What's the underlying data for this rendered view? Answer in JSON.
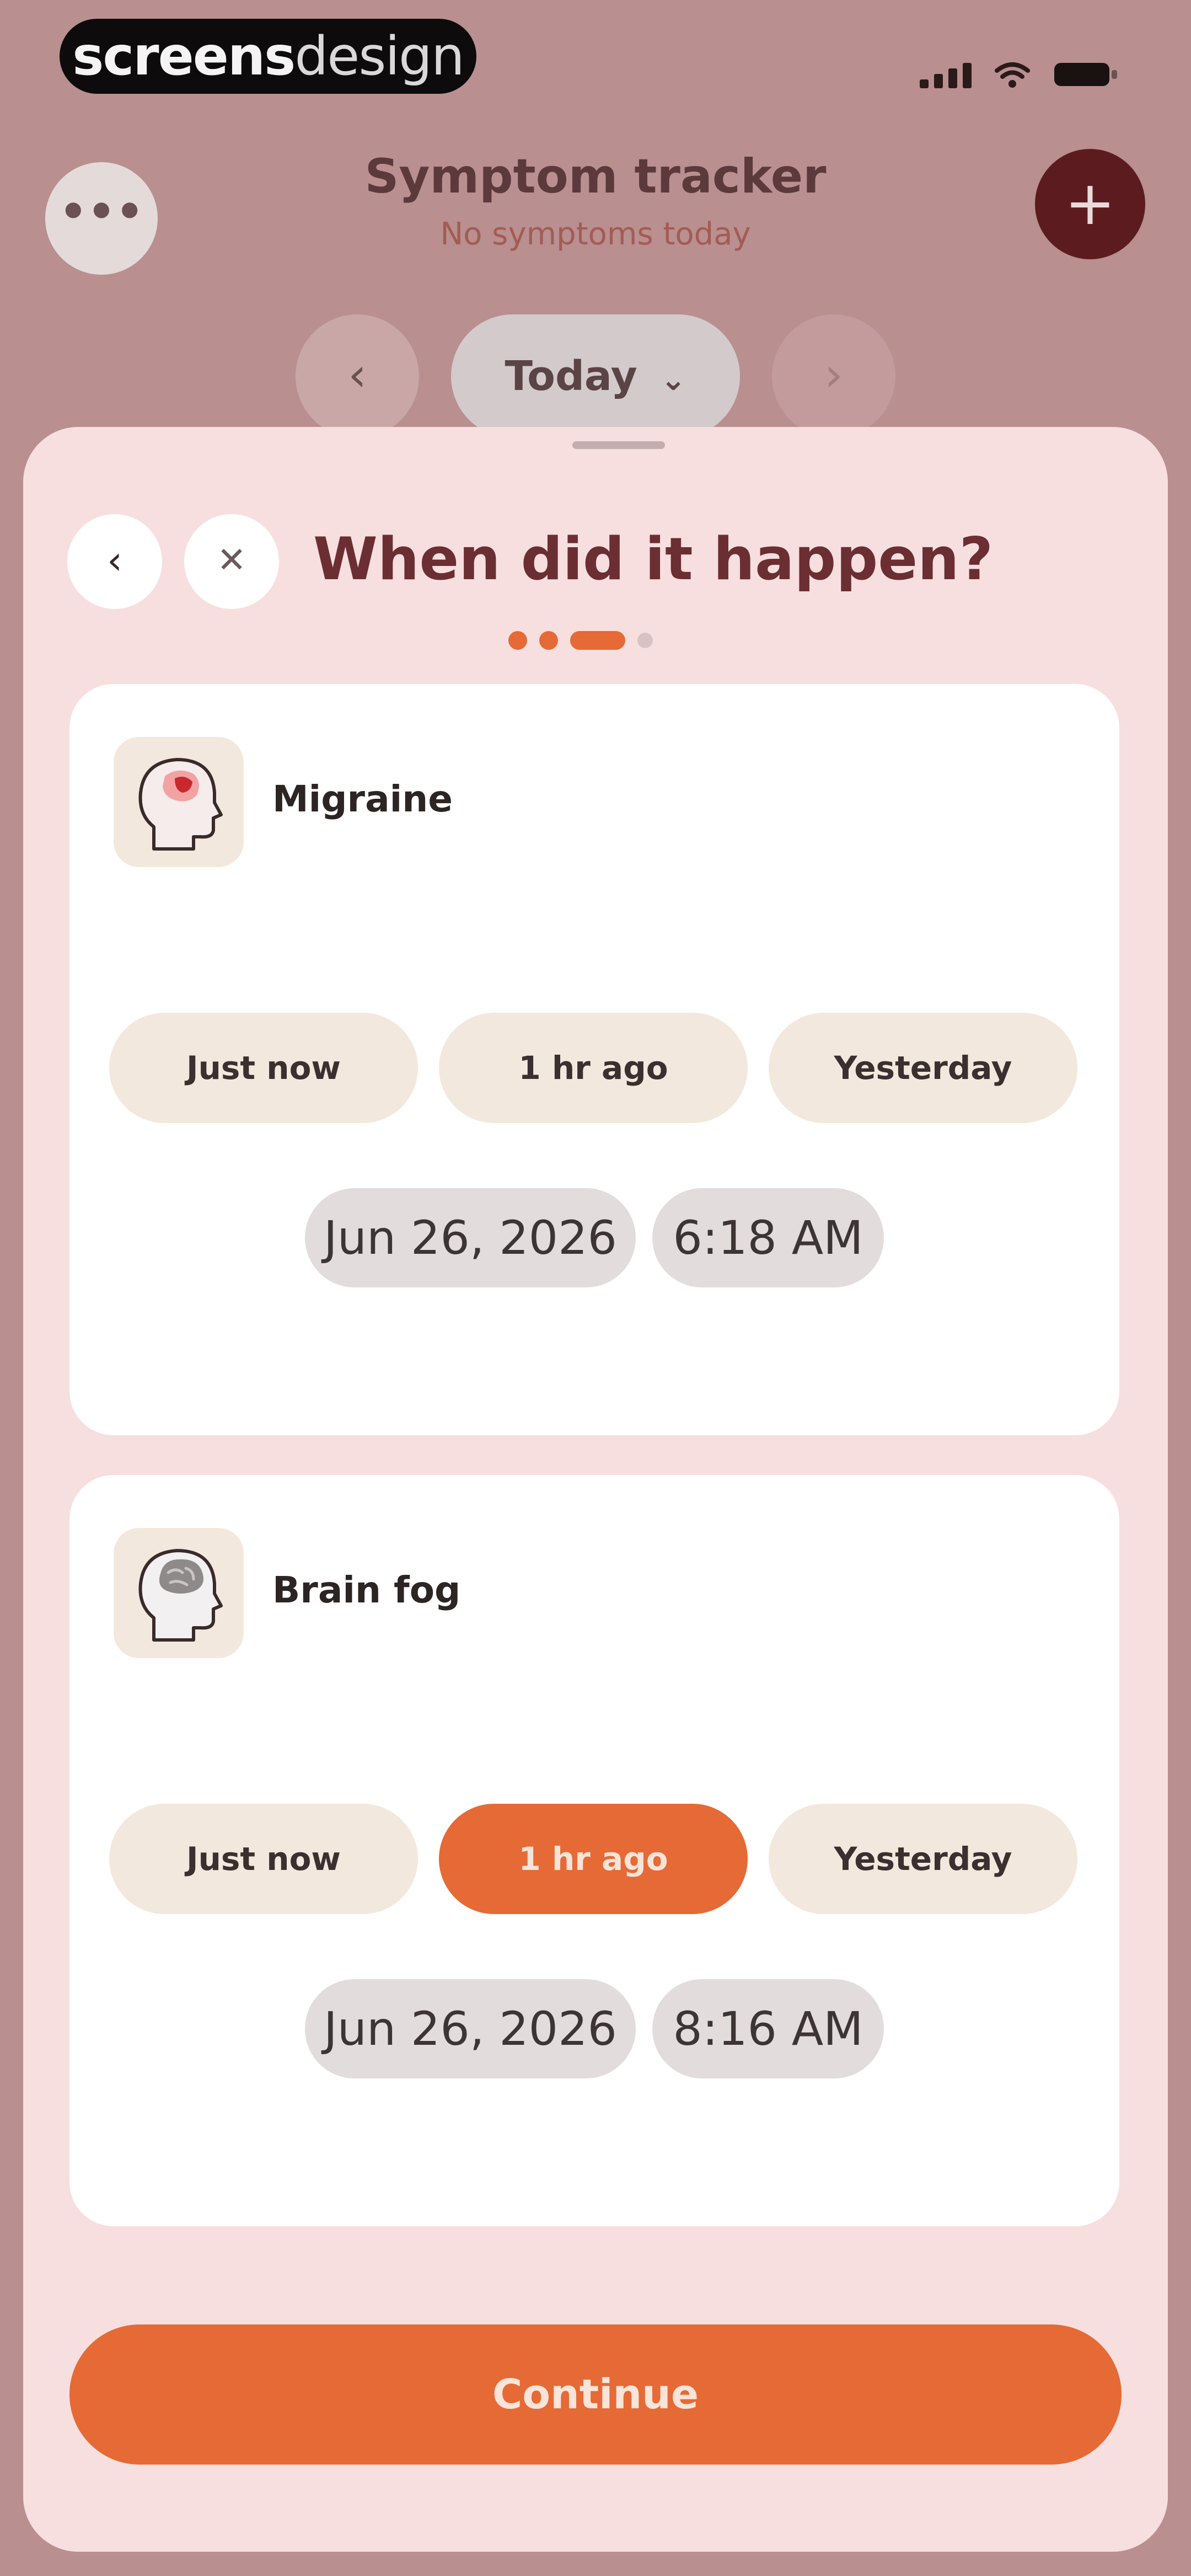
{
  "watermark": {
    "bold": "screens",
    "light": "design"
  },
  "header": {
    "title": "Symptom tracker",
    "subtitle": "No symptoms today",
    "more_label": "•••",
    "add_label": "+",
    "prev_label": "‹",
    "next_label": "›",
    "date_selector_label": "Today",
    "date_selector_chevron": "⌄"
  },
  "sheet": {
    "title": "When did it happen?",
    "back_label": "‹",
    "close_label": "✕",
    "progress": {
      "total_steps": 4,
      "current_step": 3
    },
    "symptoms": [
      {
        "name": "Migraine",
        "icon": "migraine-head-icon",
        "options": [
          "Just now",
          "1 hr ago",
          "Yesterday"
        ],
        "selected_index": -1,
        "date": "Jun 26, 2026",
        "time": "6:18 AM"
      },
      {
        "name": "Brain fog",
        "icon": "brain-fog-head-icon",
        "options": [
          "Just now",
          "1 hr ago",
          "Yesterday"
        ],
        "selected_index": 1,
        "date": "Jun 26, 2026",
        "time": "8:16 AM"
      }
    ],
    "continue_label": "Continue"
  },
  "colors": {
    "accent": "#e56a36",
    "backdrop": "#b98f90",
    "sheet": "#f7dfdf",
    "title": "#6b2e33",
    "add_button": "#5c1c1f"
  }
}
